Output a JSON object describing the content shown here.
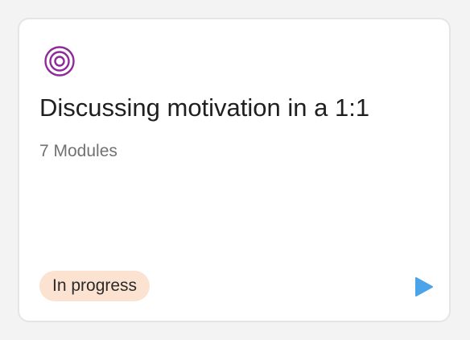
{
  "card": {
    "icon": "target-icon",
    "icon_color": "#8e2a99",
    "title": "Discussing motivation in a 1:1",
    "subtitle": "7 Modules",
    "status_badge": "In progress",
    "badge_color": "#fbe2d1",
    "play_icon": "play-icon",
    "play_color": "#4ba3ea"
  }
}
